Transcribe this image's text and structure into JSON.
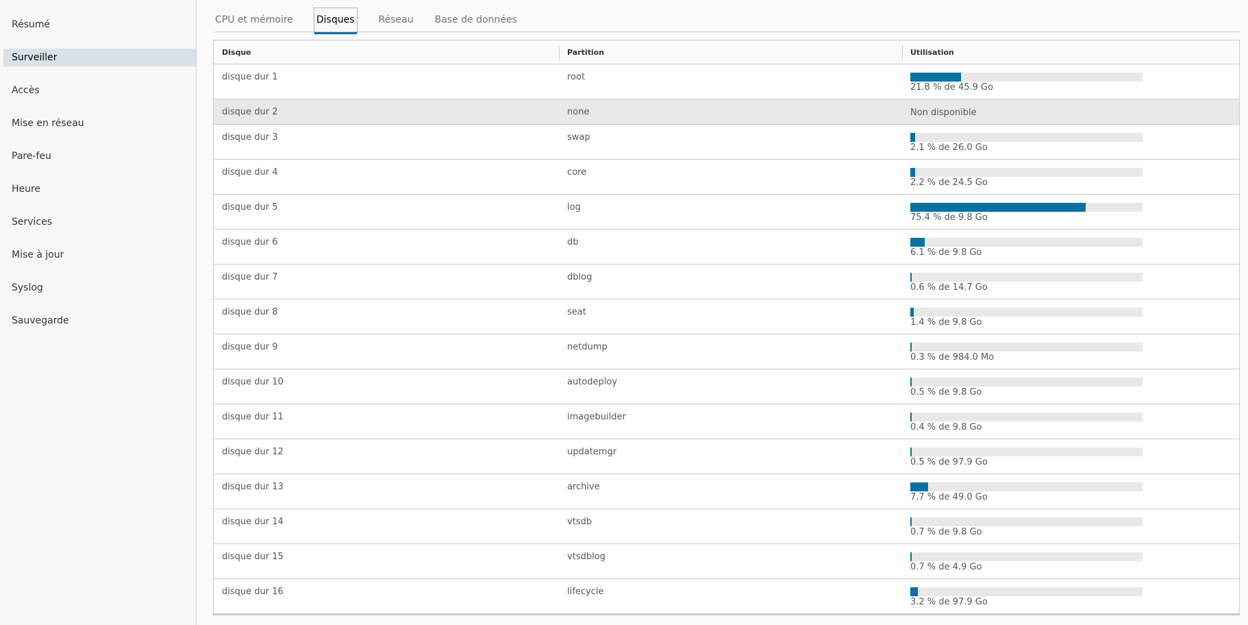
{
  "sidebar": {
    "items": [
      {
        "label": "Résumé",
        "active": false
      },
      {
        "label": "Surveiller",
        "active": true
      },
      {
        "label": "Accès",
        "active": false
      },
      {
        "label": "Mise en réseau",
        "active": false
      },
      {
        "label": "Pare-feu",
        "active": false
      },
      {
        "label": "Heure",
        "active": false
      },
      {
        "label": "Services",
        "active": false
      },
      {
        "label": "Mise à jour",
        "active": false
      },
      {
        "label": "Syslog",
        "active": false
      },
      {
        "label": "Sauvegarde",
        "active": false
      }
    ]
  },
  "tabs": [
    {
      "label": "CPU et mémoire",
      "active": false
    },
    {
      "label": "Disques",
      "active": true
    },
    {
      "label": "Réseau",
      "active": false
    },
    {
      "label": "Base de données",
      "active": false
    }
  ],
  "grid": {
    "columns": [
      "Disque",
      "Partition",
      "Utilisation"
    ],
    "rows": [
      {
        "disk": "disque dur 1",
        "partition": "root",
        "usage_percent": 21.8,
        "usage_text": "21.8 % de 45.9 Go"
      },
      {
        "disk": "disque dur 2",
        "partition": "none",
        "usage_percent": null,
        "usage_text": "Non disponible"
      },
      {
        "disk": "disque dur 3",
        "partition": "swap",
        "usage_percent": 2.1,
        "usage_text": "2.1 % de 26.0 Go"
      },
      {
        "disk": "disque dur 4",
        "partition": "core",
        "usage_percent": 2.2,
        "usage_text": "2.2 % de 24.5 Go"
      },
      {
        "disk": "disque dur 5",
        "partition": "log",
        "usage_percent": 75.4,
        "usage_text": "75.4 % de 9.8 Go"
      },
      {
        "disk": "disque dur 6",
        "partition": "db",
        "usage_percent": 6.1,
        "usage_text": "6.1 % de 9.8 Go"
      },
      {
        "disk": "disque dur 7",
        "partition": "dblog",
        "usage_percent": 0.6,
        "usage_text": "0.6 % de 14.7 Go"
      },
      {
        "disk": "disque dur 8",
        "partition": "seat",
        "usage_percent": 1.4,
        "usage_text": "1.4 % de 9.8 Go"
      },
      {
        "disk": "disque dur 9",
        "partition": "netdump",
        "usage_percent": 0.3,
        "usage_text": "0.3 % de 984.0 Mo"
      },
      {
        "disk": "disque dur 10",
        "partition": "autodeploy",
        "usage_percent": 0.5,
        "usage_text": "0.5 % de 9.8 Go"
      },
      {
        "disk": "disque dur 11",
        "partition": "imagebuilder",
        "usage_percent": 0.4,
        "usage_text": "0.4 % de 9.8 Go"
      },
      {
        "disk": "disque dur 12",
        "partition": "updatemgr",
        "usage_percent": 0.5,
        "usage_text": "0.5 % de 97.9 Go"
      },
      {
        "disk": "disque dur 13",
        "partition": "archive",
        "usage_percent": 7.7,
        "usage_text": "7.7 % de 49.0 Go"
      },
      {
        "disk": "disque dur 14",
        "partition": "vtsdb",
        "usage_percent": 0.7,
        "usage_text": "0.7 % de 9.8 Go"
      },
      {
        "disk": "disque dur 15",
        "partition": "vtsdblog",
        "usage_percent": 0.7,
        "usage_text": "0.7 % de 4.9 Go"
      },
      {
        "disk": "disque dur 16",
        "partition": "lifecycle",
        "usage_percent": 3.2,
        "usage_text": "3.2 % de 97.9 Go"
      }
    ]
  },
  "colors": {
    "accent": "#0072a3",
    "bar_track": "#e8e8e8",
    "sidebar_active": "#d8e3e9"
  }
}
